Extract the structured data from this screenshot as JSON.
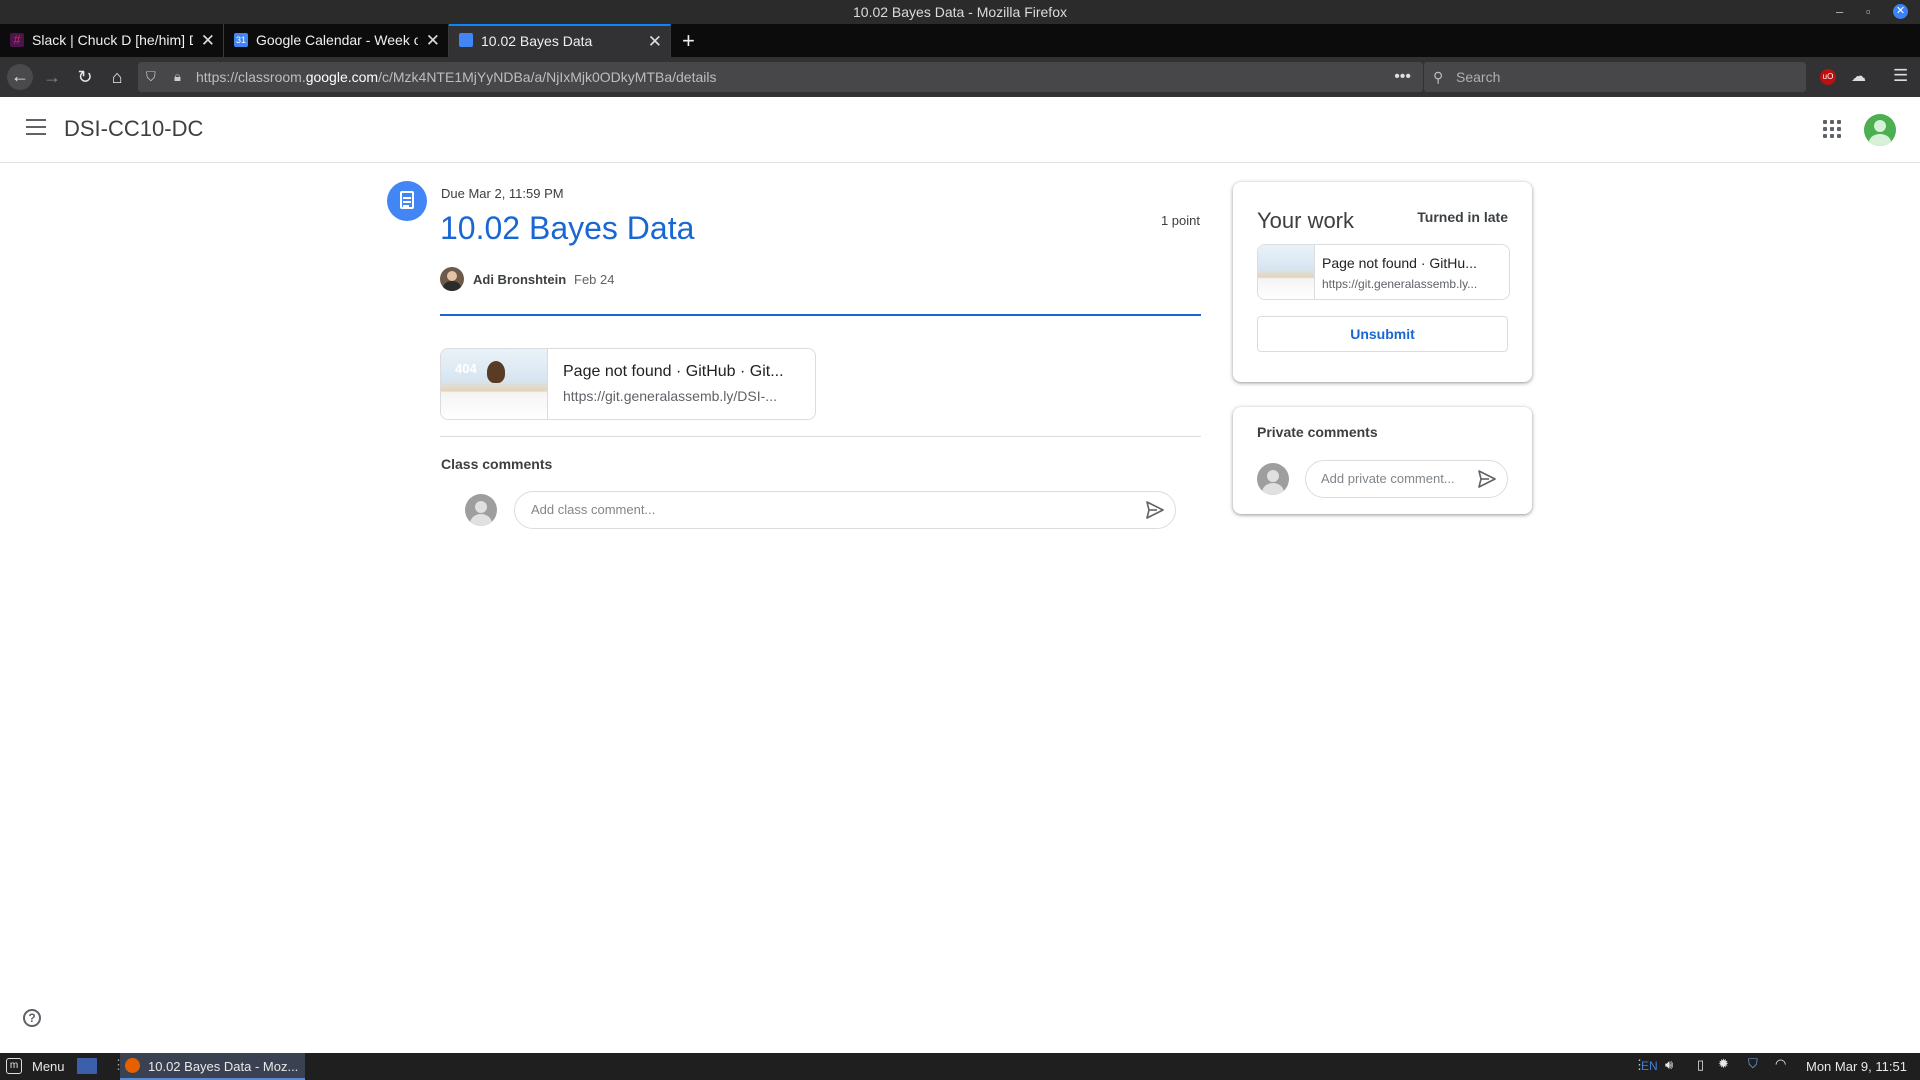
{
  "window": {
    "title": "10.02 Bayes Data - Mozilla Firefox"
  },
  "tabs": [
    {
      "label": "Slack | Chuck D [he/him] DC",
      "icon": "slack-icon"
    },
    {
      "label": "Google Calendar - Week of",
      "icon": "calendar-icon"
    },
    {
      "label": "10.02 Bayes Data",
      "icon": "classroom-icon"
    }
  ],
  "navbar": {
    "url_prefix": "https://classroom.",
    "url_domain": "google.com",
    "url_path": "/c/Mzk4NTE1MjYyNDBa/a/NjIxMjk0ODkyMTBa/details",
    "search_placeholder": "Search"
  },
  "app": {
    "class_name": "DSI-CC10-DC"
  },
  "assignment": {
    "due": "Due Mar 2, 11:59 PM",
    "title": "10.02 Bayes Data",
    "points": "1 point",
    "author": "Adi Bronshtein",
    "date": "Feb 24",
    "attachment_title": "Page not found · GitHub · Git...",
    "attachment_url": "https://git.generalassemb.ly/DSI-...",
    "thumb_badge": "404"
  },
  "class_comments": {
    "heading": "Class comments",
    "placeholder": "Add class comment..."
  },
  "your_work": {
    "heading": "Your work",
    "status": "Turned in late",
    "attachment_title": "Page not found · GitHu...",
    "attachment_url": "https://git.generalassemb.ly...",
    "unsubmit_label": "Unsubmit"
  },
  "private_comments": {
    "heading": "Private comments",
    "placeholder": "Add private comment..."
  },
  "taskbar": {
    "menu_label": "Menu",
    "task_label": "10.02 Bayes Data - Moz...",
    "lang": "EN",
    "clock": "Mon Mar 9, 11:51"
  },
  "colors": {
    "accent_blue": "#1967d2",
    "firefox_tab_active": "#323234",
    "assignment_icon_bg": "#4285f4"
  }
}
